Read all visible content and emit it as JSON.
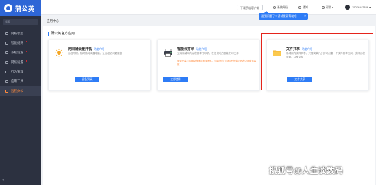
{
  "sidebar": {
    "logo_text": "蒲公英",
    "search_placeholder": "搜索",
    "items": [
      {
        "label": "网络状态"
      },
      {
        "label": "智能组网"
      },
      {
        "label": "系统设置"
      },
      {
        "label": "网络设置"
      },
      {
        "label": "行为管理"
      },
      {
        "label": "应用工具"
      },
      {
        "label": "远程办公",
        "active": true
      }
    ],
    "collapse_icon": "double-chevron-left-icon"
  },
  "topbar": {
    "download_label": "下载手机客户端",
    "system_upgrade_label": "系统升级",
    "notice_label": "通知",
    "help_label": "帮助",
    "user_label": "1507****2846",
    "tooltip_text": "遇到问题了? 试试搜索帮助吧~"
  },
  "breadcrumb": "应用中心",
  "section_title": "蒲公英官方应用",
  "cards": [
    {
      "title": "阿田蒲云暖开机",
      "link": "功能介绍",
      "desc": "远程开机，随时随地唤醒电脑，让远程访问更便捷",
      "warn": "",
      "button": "设备列表",
      "icon": "sun-icon"
    },
    {
      "title": "智能云打印",
      "link": "功能介绍",
      "desc": "支持局域网内远程共享打印机，在任何地方都能打印文件",
      "warn": "需要安装打印驱动程序及相关固件，如果您的打印机不在支持列表中请联系客服",
      "button": "立即使用",
      "icon": "printer-icon"
    },
    {
      "title": "文件共享",
      "link": "功能介绍",
      "desc": "局域网内文件共享，只需简单几步即可创建一个文件共享空间，支持远程查看、共享文件",
      "warn": "",
      "button": "文件共享",
      "icon": "folder-icon"
    }
  ],
  "watermark": "搜狐号@人生谈数码",
  "colors": {
    "primary": "#2e7cf6",
    "sidebar_bg": "#2c3140",
    "logo_bg": "#2e66d6",
    "highlight": "#e5241b",
    "active_nav": "#ff8a3d"
  }
}
